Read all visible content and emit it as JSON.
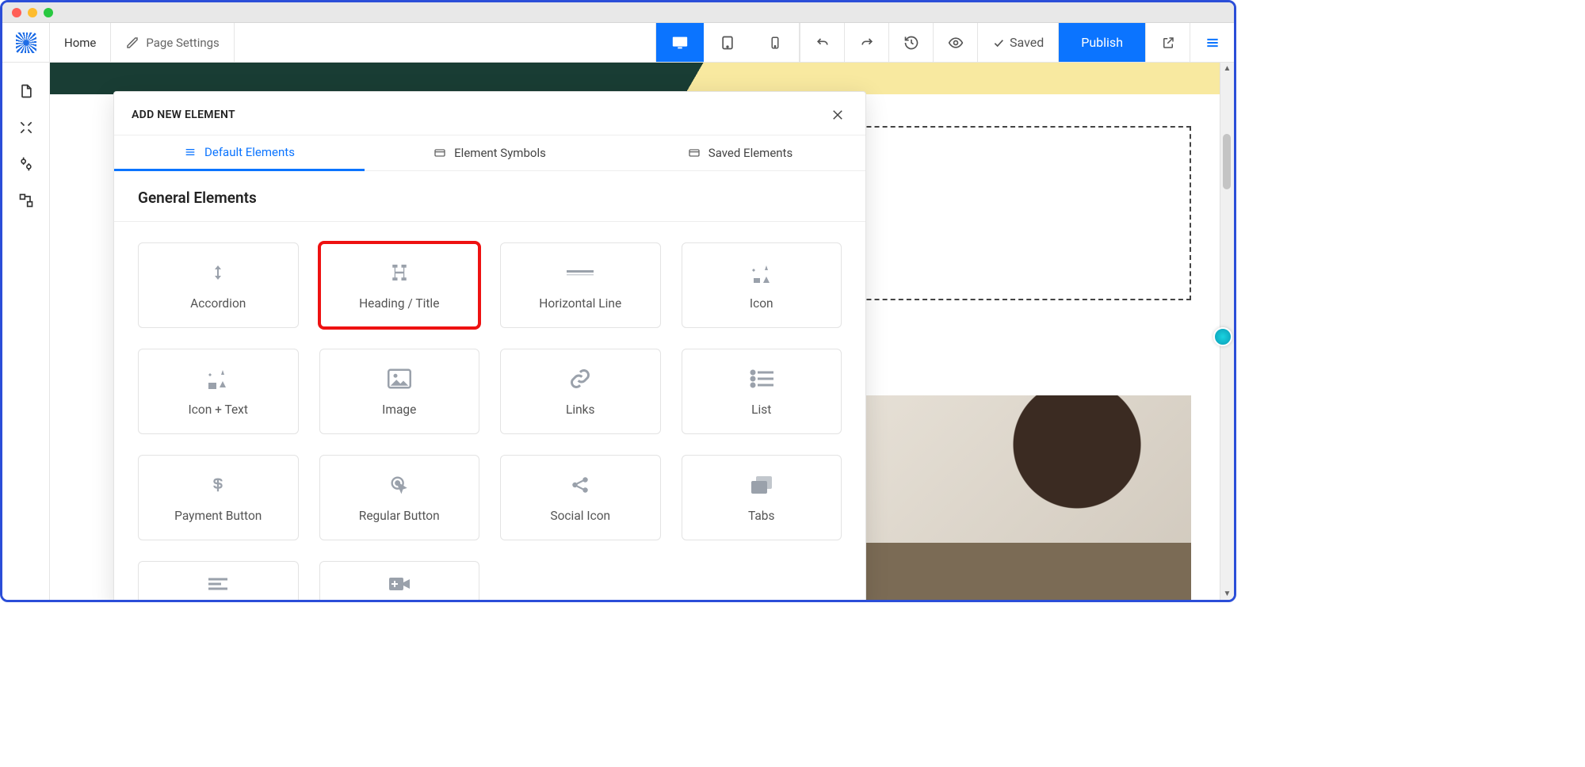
{
  "topbar": {
    "home": "Home",
    "page_settings": "Page Settings",
    "saved": "Saved",
    "publish": "Publish"
  },
  "modal": {
    "title": "ADD NEW ELEMENT",
    "tabs": [
      "Default Elements",
      "Element Symbols",
      "Saved Elements"
    ],
    "section": "General Elements",
    "elements_row1": [
      "Accordion",
      "Heading / Title",
      "Horizontal Line",
      "Icon"
    ],
    "elements_row2": [
      "Icon + Text",
      "Image",
      "Links",
      "List"
    ],
    "elements_row3": [
      "Payment Button",
      "Regular Button",
      "Social Icon",
      "Tabs"
    ],
    "highlighted_index": 1
  }
}
